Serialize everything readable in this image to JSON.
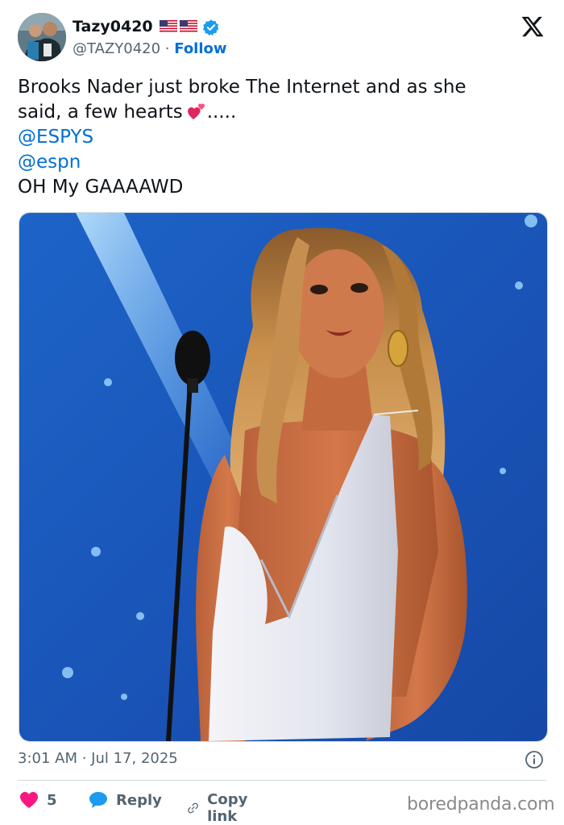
{
  "user": {
    "display_name": "Tazy0420",
    "handle": "@TAZY0420",
    "separator": "·",
    "follow_label": "Follow"
  },
  "icons": {
    "brand": "x-logo-icon",
    "verified": "verified-badge-icon",
    "info": "info-icon",
    "like": "heart-icon",
    "reply": "reply-bubble-icon",
    "copy": "link-icon"
  },
  "tweet": {
    "line1": "Brooks Nader just broke The Internet and as she",
    "line2_text": "said, a few hearts",
    "line2_suffix": ".....",
    "mention1": "@ESPYS",
    "mention2": "@espn",
    "line_last": "OH My GAAAAWD"
  },
  "meta": {
    "timestamp": "3:01 AM · Jul 17, 2025"
  },
  "actions": {
    "like_count": "5",
    "reply_label": "Reply",
    "copy_label": "Copy link"
  },
  "watermark": "boredpanda.com",
  "colors": {
    "link": "#006fd6",
    "muted": "#536471",
    "like": "#f91880",
    "reply": "#1d9bf0",
    "verified": "#1d9bf0"
  }
}
